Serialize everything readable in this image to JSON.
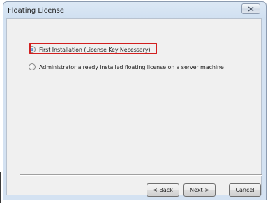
{
  "window": {
    "title": "Floating License",
    "close_icon": "close-icon"
  },
  "options": [
    {
      "label": "First Installation (License Key Necessary)",
      "selected": true,
      "highlighted": true
    },
    {
      "label": "Administrator already installed floating license on a server machine",
      "selected": false,
      "highlighted": false
    }
  ],
  "buttons": {
    "back_label": "< Back",
    "next_label": "Next >",
    "cancel_label": "Cancel"
  },
  "colors": {
    "highlight": "#d21f1f",
    "radio_selected": "#2a6bb5"
  }
}
